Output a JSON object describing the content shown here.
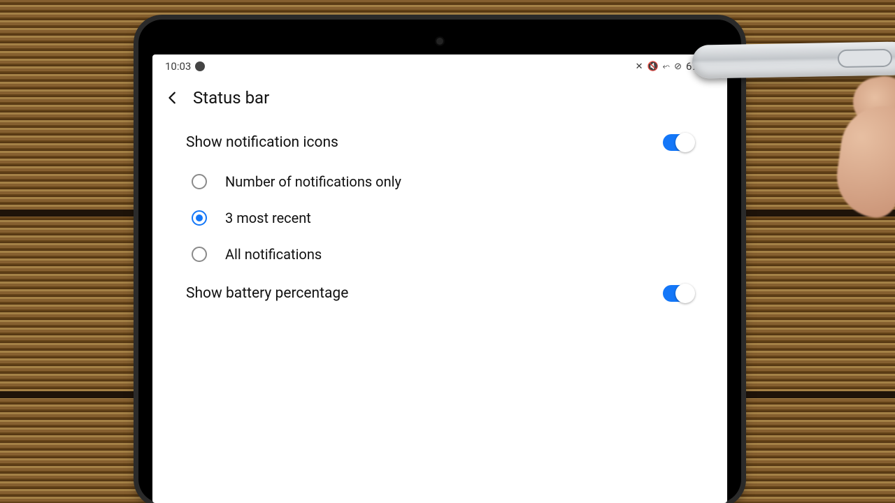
{
  "statusbar": {
    "time": "10:03",
    "battery_text": "67%"
  },
  "header": {
    "title": "Status bar"
  },
  "settings": {
    "show_notification_icons": {
      "label": "Show notification icons",
      "enabled": true
    },
    "radio_options": [
      {
        "label": "Number of notifications only",
        "selected": false
      },
      {
        "label": "3 most recent",
        "selected": true
      },
      {
        "label": "All notifications",
        "selected": false
      }
    ],
    "show_battery_percentage": {
      "label": "Show battery percentage",
      "enabled": true
    }
  },
  "colors": {
    "accent": "#1477f8"
  }
}
